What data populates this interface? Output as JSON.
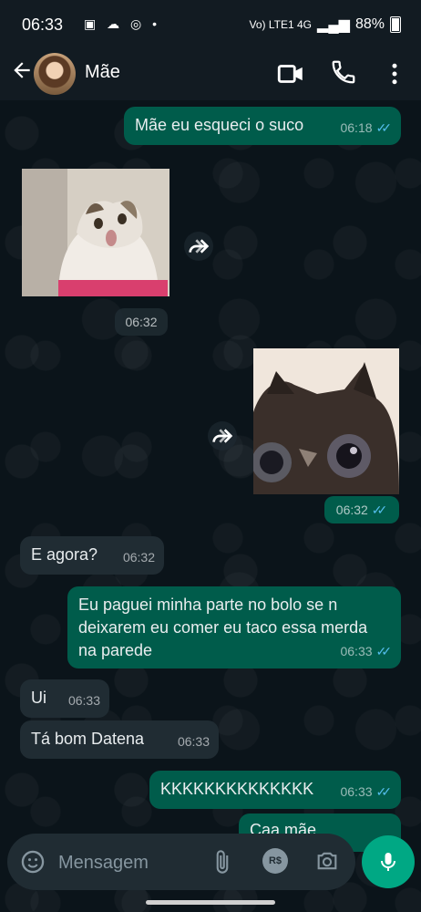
{
  "status_bar": {
    "time": "06:33",
    "left_icons": "▣ ☁ ◎ •",
    "network": "Vo) LTE1 4G",
    "battery": "88%"
  },
  "header": {
    "contact_name": "Mãe"
  },
  "messages": [
    {
      "type": "text",
      "direction": "out",
      "text": "Mãe eu esqueci o suco",
      "time": "06:18",
      "read": true
    },
    {
      "type": "image",
      "direction": "in",
      "subject": "cat-looking-up",
      "time": "06:32"
    },
    {
      "type": "image",
      "direction": "out",
      "subject": "cat-closeup",
      "time": "06:32",
      "read": true
    },
    {
      "type": "text",
      "direction": "in",
      "text": "E agora?",
      "time": "06:32"
    },
    {
      "type": "text",
      "direction": "out",
      "text": "Eu paguei minha parte no bolo se n deixarem eu comer eu taco essa merda na parede",
      "time": "06:33",
      "read": true
    },
    {
      "type": "text",
      "direction": "in",
      "text": "Ui",
      "time": "06:33"
    },
    {
      "type": "text",
      "direction": "in",
      "text": "Tá bom Datena",
      "time": "06:33"
    },
    {
      "type": "text",
      "direction": "out",
      "text": "KKKKKKKKKKKKKK",
      "time": "06:33",
      "read": true
    },
    {
      "type": "text",
      "direction": "out",
      "text": "Caa mãe",
      "time": "",
      "partial": true
    }
  ],
  "input": {
    "placeholder": "Mensagem",
    "pix_label": "R$"
  },
  "colors": {
    "outgoing_bubble": "#005c4b",
    "incoming_bubble": "#202c33",
    "read_ticks": "#53bdeb",
    "mic_button": "#00a884"
  }
}
